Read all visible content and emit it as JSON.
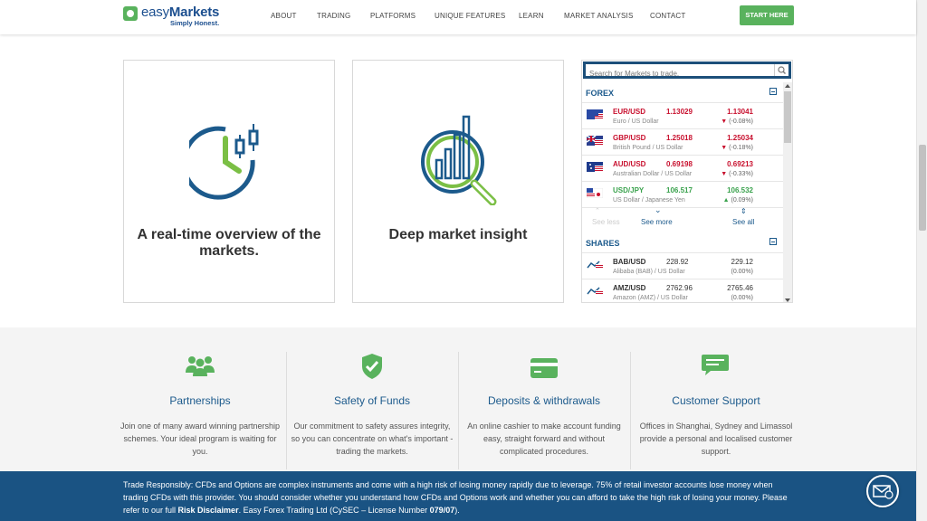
{
  "header": {
    "logo_brand_light": "easy",
    "logo_brand_bold": "Markets",
    "logo_tagline": "Simply Honest.",
    "nav": [
      "ABOUT",
      "TRADING",
      "PLATFORMS",
      "UNIQUE FEATURES",
      "LEARN",
      "MARKET ANALYSIS",
      "CONTACT"
    ],
    "start_label": "START HERE"
  },
  "cards": [
    {
      "title": "A real-time overview of the markets.",
      "icon": "clock-candlestick-icon"
    },
    {
      "title": "Deep market insight",
      "icon": "chart-magnifier-icon"
    }
  ],
  "widget": {
    "search_placeholder": "Search for Markets to trade.",
    "forex": {
      "title": "FOREX",
      "rows": [
        {
          "symbol": "EUR/USD",
          "desc": "Euro / US Dollar",
          "bid": "1.13029",
          "ask": "1.13041",
          "change": "(-0.08%)",
          "dir": "down"
        },
        {
          "symbol": "GBP/USD",
          "desc": "British Pound / US Dollar",
          "bid": "1.25018",
          "ask": "1.25034",
          "change": "(-0.18%)",
          "dir": "down"
        },
        {
          "symbol": "AUD/USD",
          "desc": "Australian Dollar / US Dollar",
          "bid": "0.69198",
          "ask": "0.69213",
          "change": "(-0.33%)",
          "dir": "down"
        },
        {
          "symbol": "USD/JPY",
          "desc": "US Dollar / Japanese Yen",
          "bid": "106.517",
          "ask": "106.532",
          "change": "(0.09%)",
          "dir": "up"
        }
      ],
      "see_less": "See less",
      "see_more": "See more",
      "see_all": "See all"
    },
    "shares": {
      "title": "SHARES",
      "rows": [
        {
          "symbol": "BAB/USD",
          "desc": "Alibaba (BAB) / US Dollar",
          "bid": "228.92",
          "ask": "229.12",
          "change": "(0.00%)"
        },
        {
          "symbol": "AMZ/USD",
          "desc": "Amazon (AMZ) / US Dollar",
          "bid": "2762.96",
          "ask": "2765.46",
          "change": "(0.00%)"
        }
      ]
    }
  },
  "features": [
    {
      "title": "Partnerships",
      "text": "Join one of many award winning partnership schemes. Your ideal program is waiting for you.",
      "icon": "people-group-icon"
    },
    {
      "title": "Safety of Funds",
      "text": "Our commitment to safety assures integrity, so you can concentrate on what's important - trading the markets.",
      "icon": "shield-check-icon"
    },
    {
      "title": "Deposits & withdrawals",
      "text": "An online cashier to make account funding easy, straight forward and without complicated procedures.",
      "icon": "credit-card-icon"
    },
    {
      "title": "Customer Support",
      "text": "Offices in Shanghai, Sydney and Limassol provide a personal and localised customer support.",
      "icon": "chat-bubbles-icon"
    }
  ],
  "risk": {
    "text_1": "Trade Responsibly: CFDs and Options are complex instruments and come with a high risk of losing money rapidly due to leverage. 75% of retail investor accounts lose money when trading CFDs with this provider. You should consider whether you understand how CFDs and Options work and whether you can afford to take the high risk of losing your money. Please refer to our full ",
    "link": "Risk Disclaimer",
    "text_2": ". Easy Forex Trading Ltd (CySEC – License Number ",
    "license": "079/07",
    "text_3": ")."
  },
  "colors": {
    "brand_blue": "#1c5a8c",
    "green": "#59b25d",
    "red": "#c8102e",
    "banner": "#1a5383"
  }
}
